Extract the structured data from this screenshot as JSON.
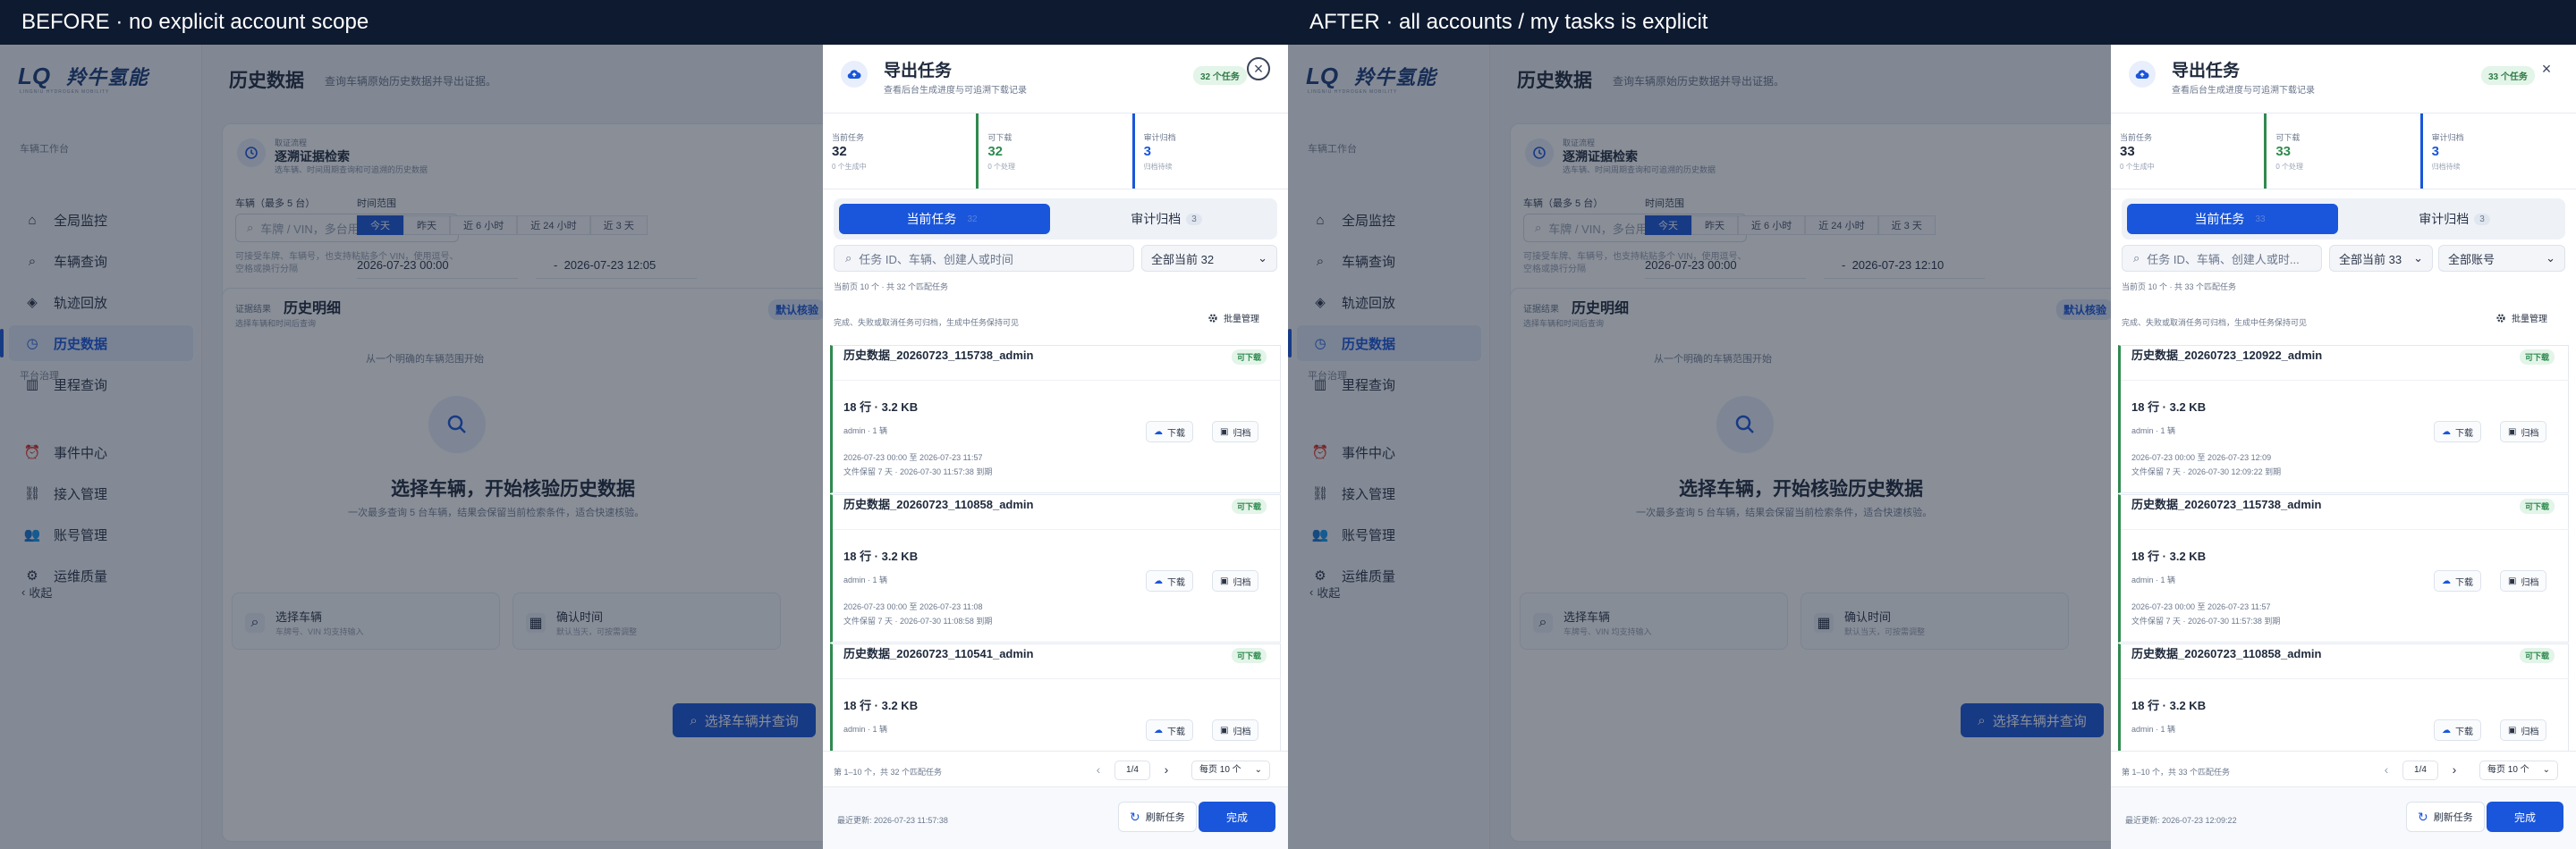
{
  "panels": [
    {
      "caption": "BEFORE · no explicit account scope",
      "app": {
        "logo_name": "羚牛氢能",
        "logo_sub": "LINGNIU HYDROGEN MOBILITY",
        "section_vehicle": "车辆工作台",
        "section_platform": "平台治理",
        "nav": [
          {
            "label": "全局监控",
            "icon": "home-icon"
          },
          {
            "label": "车辆查询",
            "icon": "search-icon"
          },
          {
            "label": "轨迹回放",
            "icon": "route-icon"
          },
          {
            "label": "历史数据",
            "icon": "history-icon"
          },
          {
            "label": "里程查询",
            "icon": "chart-icon"
          },
          {
            "label": "事件中心",
            "icon": "alarm-icon"
          },
          {
            "label": "接入管理",
            "icon": "link-icon"
          },
          {
            "label": "账号管理",
            "icon": "users-icon"
          },
          {
            "label": "运维质量",
            "icon": "gear-icon"
          }
        ],
        "collapse": "收起",
        "page_title": "历史数据",
        "page_subtitle": "查询车辆原始历史数据并导出证据。",
        "card1": {
          "kicker": "取证流程",
          "title": "逐溯证据检索",
          "desc": "选车辆、时间周期查询和可追溯的历史数据",
          "vehicle_label": "车辆（最多 5 台）",
          "vin_placeholder": "车牌 / VIN，多台用逗号分隔",
          "hint": "可接受车牌、车辆号，也支持粘贴多个 VIN，使用逗号、空格或换行分隔",
          "time_label": "时间范围",
          "segments": [
            "今天",
            "昨天",
            "近 6 小时",
            "近 24 小时",
            "近 3 天"
          ],
          "start": "2026-07-23 00:00",
          "end": "2026-07-23 12:05"
        },
        "card2": {
          "tag": "证据结果",
          "title": "历史明细",
          "sub": "选择车辆和时间后查询",
          "badge": "默认核验",
          "hero_kicker": "从一个明确的车辆范围开始",
          "hero_title": "选择车辆，开始核验历史数据",
          "hero_desc": "一次最多查询 5 台车辆，结果会保留当前检索条件，适合快速核验。",
          "steps": [
            {
              "title": "选择车辆",
              "desc": "车牌号、VIN 均支持输入"
            },
            {
              "title": "确认时间",
              "desc": "默认当天，可按需调整"
            }
          ],
          "query_btn": "选择车辆并查询"
        }
      },
      "drawer": {
        "title": "导出任务",
        "subtitle": "查看后台生成进度与可追溯下载记录",
        "badge": "32 个任务",
        "close_ring": true,
        "stats": [
          {
            "k": "当前任务",
            "v": "32",
            "n": "0 个生成中"
          },
          {
            "k": "可下载",
            "v": "32",
            "n": "0 个处理"
          },
          {
            "k": "审计归档",
            "v": "3",
            "n": "归档待续"
          }
        ],
        "tabs": [
          {
            "label": "当前任务",
            "count": "32"
          },
          {
            "label": "审计归档",
            "count": "3"
          }
        ],
        "search_placeholder": "任务 ID、车辆、创建人或时间",
        "scope_select": "全部当前 32",
        "account_select": "",
        "meta": "当前页 10 个 · 共 32 个匹配任务",
        "note": "完成、失败或取消任务可归档，生成中任务保持可见",
        "bulk": "批量管理",
        "tasks": [
          {
            "name": "历史数据_20260723_115738_admin",
            "status": "可下载",
            "size": "18 行 · 3.2 KB",
            "user": "admin · 1 辆",
            "range": "2026-07-23 00:00 至 2026-07-23 11:57",
            "keep": "文件保留 7 天 · 2026-07-30 11:57:38 到期",
            "dl": "下载",
            "arc": "归档"
          },
          {
            "name": "历史数据_20260723_110858_admin",
            "status": "可下载",
            "size": "18 行 · 3.2 KB",
            "user": "admin · 1 辆",
            "range": "2026-07-23 00:00 至 2026-07-23 11:08",
            "keep": "文件保留 7 天 · 2026-07-30 11:08:58 到期",
            "dl": "下载",
            "arc": "归档"
          },
          {
            "name": "历史数据_20260723_110541_admin",
            "status": "可下载",
            "size": "18 行 · 3.2 KB",
            "user": "admin · 1 辆",
            "range": "",
            "keep": "",
            "dl": "下载",
            "arc": "归档"
          }
        ],
        "pager": {
          "info": "第 1–10 个，共 32 个匹配任务",
          "page": "1/4",
          "size": "每页 10 个"
        },
        "updated": "最近更新: 2026-07-23 11:57:38",
        "refresh": "刷新任务",
        "done": "完成"
      }
    },
    {
      "caption": "AFTER · all accounts / my tasks is explicit",
      "app": {
        "logo_name": "羚牛氢能",
        "logo_sub": "LINGNIU HYDROGEN MOBILITY",
        "section_vehicle": "车辆工作台",
        "section_platform": "平台治理",
        "nav": [
          {
            "label": "全局监控",
            "icon": "home-icon"
          },
          {
            "label": "车辆查询",
            "icon": "search-icon"
          },
          {
            "label": "轨迹回放",
            "icon": "route-icon"
          },
          {
            "label": "历史数据",
            "icon": "history-icon"
          },
          {
            "label": "里程查询",
            "icon": "chart-icon"
          },
          {
            "label": "事件中心",
            "icon": "alarm-icon"
          },
          {
            "label": "接入管理",
            "icon": "link-icon"
          },
          {
            "label": "账号管理",
            "icon": "users-icon"
          },
          {
            "label": "运维质量",
            "icon": "gear-icon"
          }
        ],
        "collapse": "收起",
        "page_title": "历史数据",
        "page_subtitle": "查询车辆原始历史数据并导出证据。",
        "card1": {
          "kicker": "取证流程",
          "title": "逐溯证据检索",
          "desc": "选车辆、时间周期查询和可追溯的历史数据",
          "vehicle_label": "车辆（最多 5 台）",
          "vin_placeholder": "车牌 / VIN，多台用逗号分隔",
          "hint": "可接受车牌、车辆号，也支持粘贴多个 VIN，使用逗号、空格或换行分隔",
          "time_label": "时间范围",
          "segments": [
            "今天",
            "昨天",
            "近 6 小时",
            "近 24 小时",
            "近 3 天"
          ],
          "start": "2026-07-23 00:00",
          "end": "2026-07-23 12:10"
        },
        "card2": {
          "tag": "证据结果",
          "title": "历史明细",
          "sub": "选择车辆和时间后查询",
          "badge": "默认核验",
          "hero_kicker": "从一个明确的车辆范围开始",
          "hero_title": "选择车辆，开始核验历史数据",
          "hero_desc": "一次最多查询 5 台车辆，结果会保留当前检索条件，适合快速核验。",
          "steps": [
            {
              "title": "选择车辆",
              "desc": "车牌号、VIN 均支持输入"
            },
            {
              "title": "确认时间",
              "desc": "默认当天，可按需调整"
            }
          ],
          "query_btn": "选择车辆并查询"
        }
      },
      "drawer": {
        "title": "导出任务",
        "subtitle": "查看后台生成进度与可追溯下载记录",
        "badge": "33 个任务",
        "close_ring": false,
        "stats": [
          {
            "k": "当前任务",
            "v": "33",
            "n": "0 个生成中"
          },
          {
            "k": "可下载",
            "v": "33",
            "n": "0 个处理"
          },
          {
            "k": "审计归档",
            "v": "3",
            "n": "归档待续"
          }
        ],
        "tabs": [
          {
            "label": "当前任务",
            "count": "33"
          },
          {
            "label": "审计归档",
            "count": "3"
          }
        ],
        "search_placeholder": "任务 ID、车辆、创建人或时...",
        "scope_select": "全部当前 33",
        "account_select": "全部账号",
        "meta": "当前页 10 个 · 共 33 个匹配任务",
        "note": "完成、失败或取消任务可归档，生成中任务保持可见",
        "bulk": "批量管理",
        "tasks": [
          {
            "name": "历史数据_20260723_120922_admin",
            "status": "可下载",
            "size": "18 行 · 3.2 KB",
            "user": "admin · 1 辆",
            "range": "2026-07-23 00:00 至 2026-07-23 12:09",
            "keep": "文件保留 7 天 · 2026-07-30 12:09:22 到期",
            "dl": "下载",
            "arc": "归档"
          },
          {
            "name": "历史数据_20260723_115738_admin",
            "status": "可下载",
            "size": "18 行 · 3.2 KB",
            "user": "admin · 1 辆",
            "range": "2026-07-23 00:00 至 2026-07-23 11:57",
            "keep": "文件保留 7 天 · 2026-07-30 11:57:38 到期",
            "dl": "下载",
            "arc": "归档"
          },
          {
            "name": "历史数据_20260723_110858_admin",
            "status": "可下载",
            "size": "18 行 · 3.2 KB",
            "user": "admin · 1 辆",
            "range": "",
            "keep": "",
            "dl": "下载",
            "arc": "归档"
          }
        ],
        "pager": {
          "info": "第 1–10 个，共 33 个匹配任务",
          "page": "1/4",
          "size": "每页 10 个"
        },
        "updated": "最近更新: 2026-07-23 12:09:22",
        "refresh": "刷新任务",
        "done": "完成"
      }
    }
  ]
}
